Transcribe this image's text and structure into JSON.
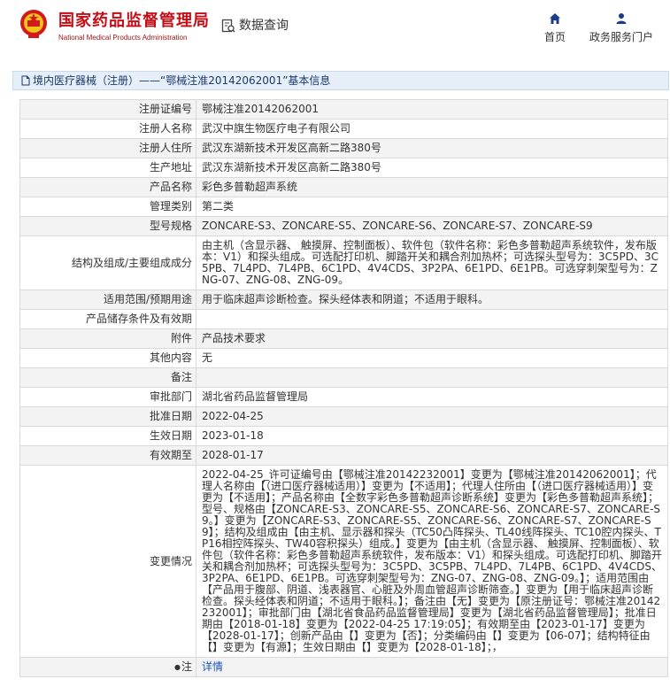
{
  "header": {
    "title_cn": "国家药品监督管理局",
    "title_en": "National Medical Products Administration",
    "data_query_label": "数据查询",
    "nav_home": "首页",
    "nav_portal": "政务服务门户"
  },
  "breadcrumb": {
    "text": "境内医疗器械（注册）——“鄂械注准20142062001”基本信息"
  },
  "rows": [
    {
      "label": "注册证编号",
      "value": "鄂械注准20142062001"
    },
    {
      "label": "注册人名称",
      "value": "武汉中旗生物医疗电子有限公司"
    },
    {
      "label": "注册人住所",
      "value": "武汉东湖新技术开发区高新二路380号"
    },
    {
      "label": "生产地址",
      "value": "武汉东湖新技术开发区高新二路380号"
    },
    {
      "label": "产品名称",
      "value": "彩色多普勒超声系统"
    },
    {
      "label": "管理类别",
      "value": "第二类"
    },
    {
      "label": "型号规格",
      "value": "ZONCARE-S3、ZONCARE-S5、ZONCARE-S6、ZONCARE-S7、ZONCARE-S9"
    },
    {
      "label": "结构及组成/主要组成成分",
      "value": "由主机（含显示器、 触摸屏、控制面板）、软件包（软件名称：彩色多普勒超声系统软件，发布版本：V1）和探头组成。可选配打印机、脚踏开关和耦合剂加热杯；可选探头型号为：3C5PD、3C5PB、7L4PD、7L4PB、6C1PD、4V4CDS、3P2PA、6E1PD、6E1PB。可选穿刺架型号为：ZNG-07、ZNG-08、ZNG-09。"
    },
    {
      "label": "适用范围/预期用途",
      "value": "用于临床超声诊断检查。探头经体表和阴道；不适用于眼科。"
    },
    {
      "label": "产品储存条件及有效期",
      "value": ""
    },
    {
      "label": "附件",
      "value": "产品技术要求"
    },
    {
      "label": "其他内容",
      "value": "无"
    },
    {
      "label": "备注",
      "value": ""
    },
    {
      "label": "审批部门",
      "value": "湖北省药品监督管理局"
    },
    {
      "label": "批准日期",
      "value": "2022-04-25"
    },
    {
      "label": "生效日期",
      "value": "2023-01-18"
    },
    {
      "label": "有效期至",
      "value": "2028-01-17"
    },
    {
      "label": "变更情况",
      "value": "2022-04-25_许可证编号由【鄂械注准20142232001】变更为【鄂械注准20142062001】；代理人名称由【（进口医疗器械适用）】变更为【不适用】；代理人住所由【（进口医疗器械适用）】变更为【不适用】；产品名称由【全数字彩色多普勒超声诊断系统】变更为【彩色多普勒超声系统】；型号、规格由【ZONCARE-S3、ZONCARE-S5、ZONCARE-S6、ZONCARE-S7、ZONCARE-S9。】变更为【ZONCARE-S3、ZONCARE-S5、ZONCARE-S6、ZONCARE-S7、ZONCARE-S9】；结构及组成由【由主机、显示器和探头（TC50凸阵探头、TL40线阵探头、TC10腔内探头、TP16相控阵探头、TW40容积探头）组成。】变更为【由主机（含显示器、 触摸屏、控制面板）、软件包（软件名称：彩色多普勒超声系统软件，发布版本：V1）和探头组成。可选配打印机、脚踏开关和耦合剂加热杯；可选探头型号为：3C5PD、3C5PB、7L4PD、7L4PB、6C1PD、4V4CDS、3P2PA、6E1PD、6E1PB。可选穿刺架型号为：ZNG-07、ZNG-08、ZNG-09。】；适用范围由【产品用于腹部、阴道、浅表器官、心脏及外周血管超声诊断筛查。】变更为【用于临床超声诊断检查。探头经体表和阴道；不适用于眼科。】；备注由【无】变更为【原注册证号：鄂械注准20142232001】；审批部门由【湖北省食品药品监督管理局】变更为【湖北省药品监督管理局】；批准日期由【2018-01-18】变更为【2022-04-25 17:19:05】；有效期至由【2023-01-17】变更为【2028-01-17】；创新产品由【】变更为【否】；分类编码由【】变更为【06-07】；结构特征由【】变更为【有源】；生效日期由【】变更为【2028-01-18】；，"
    }
  ],
  "note_row": {
    "dot": "●",
    "label": "注",
    "link": "详情"
  },
  "colors": {
    "brand_red": "#c40d16",
    "link_blue": "#1a56b8",
    "crumb_bg": "#e6eef7",
    "alt_row": "#f3f3f3"
  },
  "icons": {
    "emblem": "national-emblem-icon",
    "query": "data-query-icon",
    "home": "home-icon",
    "portal": "user-icon",
    "crumb": "document-icon"
  }
}
